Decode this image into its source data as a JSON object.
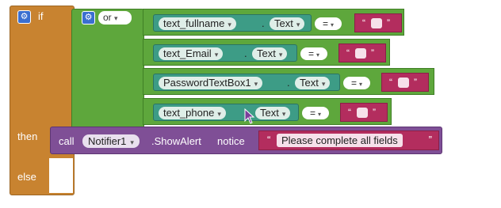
{
  "if_block": {
    "keyword_if": "if",
    "keyword_then": "then",
    "keyword_else": "else"
  },
  "or_block": {
    "operator": "or"
  },
  "conditions": [
    {
      "component": "text_fullname",
      "property": "Text",
      "operator": "=",
      "value": ""
    },
    {
      "component": "text_Email",
      "property": "Text",
      "operator": "=",
      "value": ""
    },
    {
      "component": "PasswordTextBox1",
      "property": "Text",
      "operator": "=",
      "value": ""
    },
    {
      "component": "text_phone",
      "property": "Text",
      "operator": "=",
      "value": ""
    }
  ],
  "call_block": {
    "keyword": "call",
    "component": "Notifier1",
    "method": ".ShowAlert",
    "param": "notice",
    "message": "Please complete all fields"
  },
  "glyphs": {
    "dot": ".",
    "open_quote": "“",
    "close_quote": "”",
    "dropdown_arrow": "▾",
    "gear": "⚙"
  },
  "colors": {
    "control": "#C88330",
    "logic": "#5EA73C",
    "component": "#3D9C86",
    "text": "#B32D5E",
    "procedure": "#7F4F96"
  }
}
